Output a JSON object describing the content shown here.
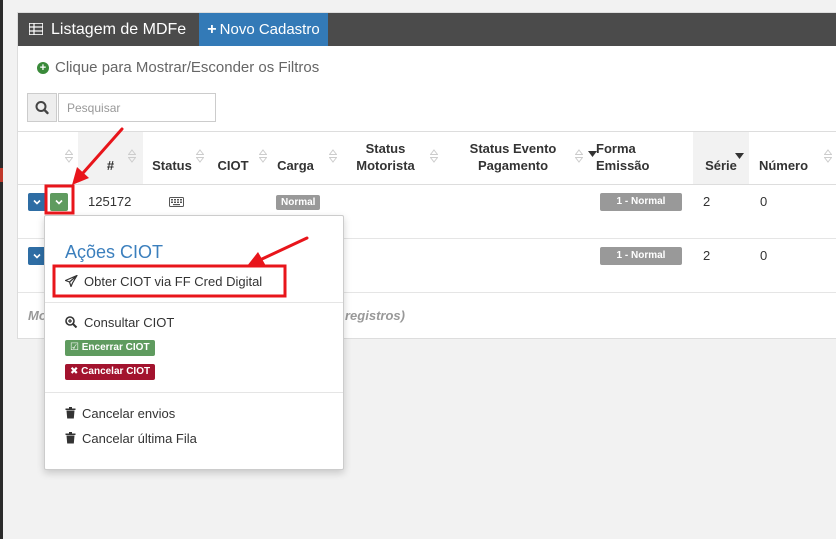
{
  "header": {
    "title": "Listagem de MDFe",
    "new_button": "Novo Cadastro"
  },
  "filters": {
    "toggle_label": "Clique para Mostrar/Esconder os Filtros"
  },
  "search": {
    "placeholder": "Pesquisar"
  },
  "table": {
    "columns": [
      "#",
      "Status",
      "CIOT",
      "Carga",
      "Status Motorista",
      "Status Evento Pagamento",
      "Forma Emissão",
      "Série",
      "Número"
    ],
    "rows": [
      {
        "id": "125172",
        "carga": "Normal",
        "forma": "1 - Normal",
        "serie": "2",
        "numero": "0"
      },
      {
        "forma": "1 - Normal",
        "serie": "2",
        "numero": "0"
      }
    ],
    "footer_left": "Mo",
    "footer_right": "registros)"
  },
  "dropdown": {
    "title": "Ações CIOT",
    "obter": "Obter CIOT via FF Cred Digital",
    "consultar": "Consultar CIOT",
    "encerrar": "Encerrar CIOT",
    "cancelar": "Cancelar CIOT",
    "cancelar_envios": "Cancelar envios",
    "cancelar_fila": "Cancelar última Fila"
  },
  "colors": {
    "header_bg": "#4b4b4b",
    "primary": "#337ab7",
    "success": "#5f9b5f",
    "danger": "#a3132e",
    "annotation": "#e8151b"
  }
}
